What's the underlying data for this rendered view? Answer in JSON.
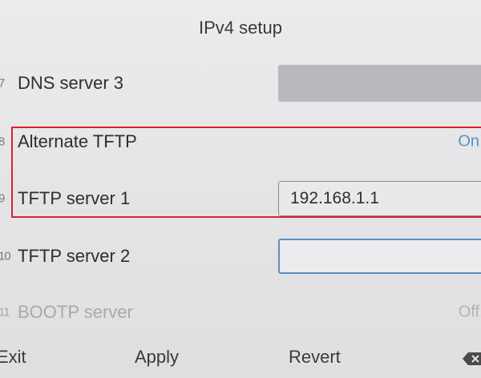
{
  "header": {
    "title": "IPv4 setup"
  },
  "rows": [
    {
      "num": "7",
      "label": "DNS server 3",
      "value": ""
    },
    {
      "num": "8",
      "label": "Alternate TFTP",
      "value": "On"
    },
    {
      "num": "9",
      "label": "TFTP server 1",
      "value": "192.168.1.1"
    },
    {
      "num": "10",
      "label": "TFTP server 2",
      "value": ""
    },
    {
      "num": "11",
      "label": "BOOTP server",
      "value": "Off"
    }
  ],
  "softkeys": {
    "exit": "Exit",
    "apply": "Apply",
    "revert": "Revert",
    "backspace_icon": "backspace-icon"
  },
  "colors": {
    "accent": "#4f97c9",
    "highlight": "#e0212b",
    "disabled_field": "#b7b9bd"
  }
}
